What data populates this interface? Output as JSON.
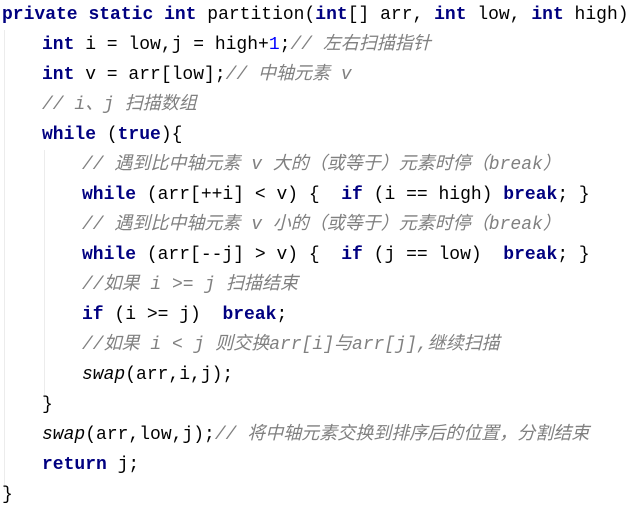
{
  "code": {
    "lines": [
      {
        "indent": 0,
        "tokens": [
          {
            "t": "kw",
            "v": "private"
          },
          {
            "t": "plain",
            "v": " "
          },
          {
            "t": "kw",
            "v": "static"
          },
          {
            "t": "plain",
            "v": " "
          },
          {
            "t": "kw",
            "v": "int"
          },
          {
            "t": "plain",
            "v": " partition("
          },
          {
            "t": "kw",
            "v": "int"
          },
          {
            "t": "plain",
            "v": "[] arr, "
          },
          {
            "t": "kw",
            "v": "int"
          },
          {
            "t": "plain",
            "v": " low, "
          },
          {
            "t": "kw",
            "v": "int"
          },
          {
            "t": "plain",
            "v": " high) {"
          }
        ]
      },
      {
        "indent": 1,
        "tokens": [
          {
            "t": "kw",
            "v": "int"
          },
          {
            "t": "plain",
            "v": " i = low,j = high+"
          },
          {
            "t": "num",
            "v": "1"
          },
          {
            "t": "plain",
            "v": ";"
          },
          {
            "t": "cmt",
            "v": "// 左右扫描指针"
          }
        ]
      },
      {
        "indent": 1,
        "tokens": [
          {
            "t": "kw",
            "v": "int"
          },
          {
            "t": "plain",
            "v": " v = arr[low];"
          },
          {
            "t": "cmt",
            "v": "// 中轴元素 v"
          }
        ]
      },
      {
        "indent": 1,
        "tokens": [
          {
            "t": "cmt",
            "v": "// i、j 扫描数组"
          }
        ]
      },
      {
        "indent": 1,
        "tokens": [
          {
            "t": "kw",
            "v": "while"
          },
          {
            "t": "plain",
            "v": " ("
          },
          {
            "t": "kw",
            "v": "true"
          },
          {
            "t": "plain",
            "v": "){"
          }
        ]
      },
      {
        "indent": 2,
        "tokens": [
          {
            "t": "cmt",
            "v": "// 遇到比中轴元素 v 大的（或等于）元素时停（break）"
          }
        ]
      },
      {
        "indent": 2,
        "tokens": [
          {
            "t": "kw",
            "v": "while"
          },
          {
            "t": "plain",
            "v": " (arr[++i] < v) {  "
          },
          {
            "t": "kw",
            "v": "if"
          },
          {
            "t": "plain",
            "v": " (i == high) "
          },
          {
            "t": "kw",
            "v": "break"
          },
          {
            "t": "plain",
            "v": "; }"
          }
        ]
      },
      {
        "indent": 2,
        "tokens": [
          {
            "t": "cmt",
            "v": "// 遇到比中轴元素 v 小的（或等于）元素时停（break）"
          }
        ]
      },
      {
        "indent": 2,
        "tokens": [
          {
            "t": "kw",
            "v": "while"
          },
          {
            "t": "plain",
            "v": " (arr[--j] > v) {  "
          },
          {
            "t": "kw",
            "v": "if"
          },
          {
            "t": "plain",
            "v": " (j == low)  "
          },
          {
            "t": "kw",
            "v": "break"
          },
          {
            "t": "plain",
            "v": "; }"
          }
        ]
      },
      {
        "indent": 2,
        "tokens": [
          {
            "t": "cmt",
            "v": "//如果 i >= j 扫描结束"
          }
        ]
      },
      {
        "indent": 2,
        "tokens": [
          {
            "t": "kw",
            "v": "if"
          },
          {
            "t": "plain",
            "v": " (i >= j)  "
          },
          {
            "t": "kw",
            "v": "break"
          },
          {
            "t": "plain",
            "v": ";"
          }
        ]
      },
      {
        "indent": 2,
        "tokens": [
          {
            "t": "cmt",
            "v": "//如果 i < j 则交换arr[i]与arr[j],继续扫描"
          }
        ]
      },
      {
        "indent": 2,
        "tokens": [
          {
            "t": "fn",
            "v": "swap"
          },
          {
            "t": "plain",
            "v": "(arr,i,j);"
          }
        ]
      },
      {
        "indent": 1,
        "tokens": [
          {
            "t": "plain",
            "v": "}"
          }
        ]
      },
      {
        "indent": 1,
        "tokens": [
          {
            "t": "fn",
            "v": "swap"
          },
          {
            "t": "plain",
            "v": "(arr,low,j);"
          },
          {
            "t": "cmt",
            "v": "// 将中轴元素交换到排序后的位置，分割结束"
          }
        ]
      },
      {
        "indent": 1,
        "tokens": [
          {
            "t": "kw",
            "v": "return"
          },
          {
            "t": "plain",
            "v": " j;"
          }
        ]
      },
      {
        "indent": 0,
        "tokens": [
          {
            "t": "plain",
            "v": "}"
          }
        ]
      }
    ]
  },
  "colors": {
    "keyword": "#000080",
    "number": "#0000ff",
    "comment": "#808080",
    "text": "#000000",
    "background": "#ffffff"
  }
}
